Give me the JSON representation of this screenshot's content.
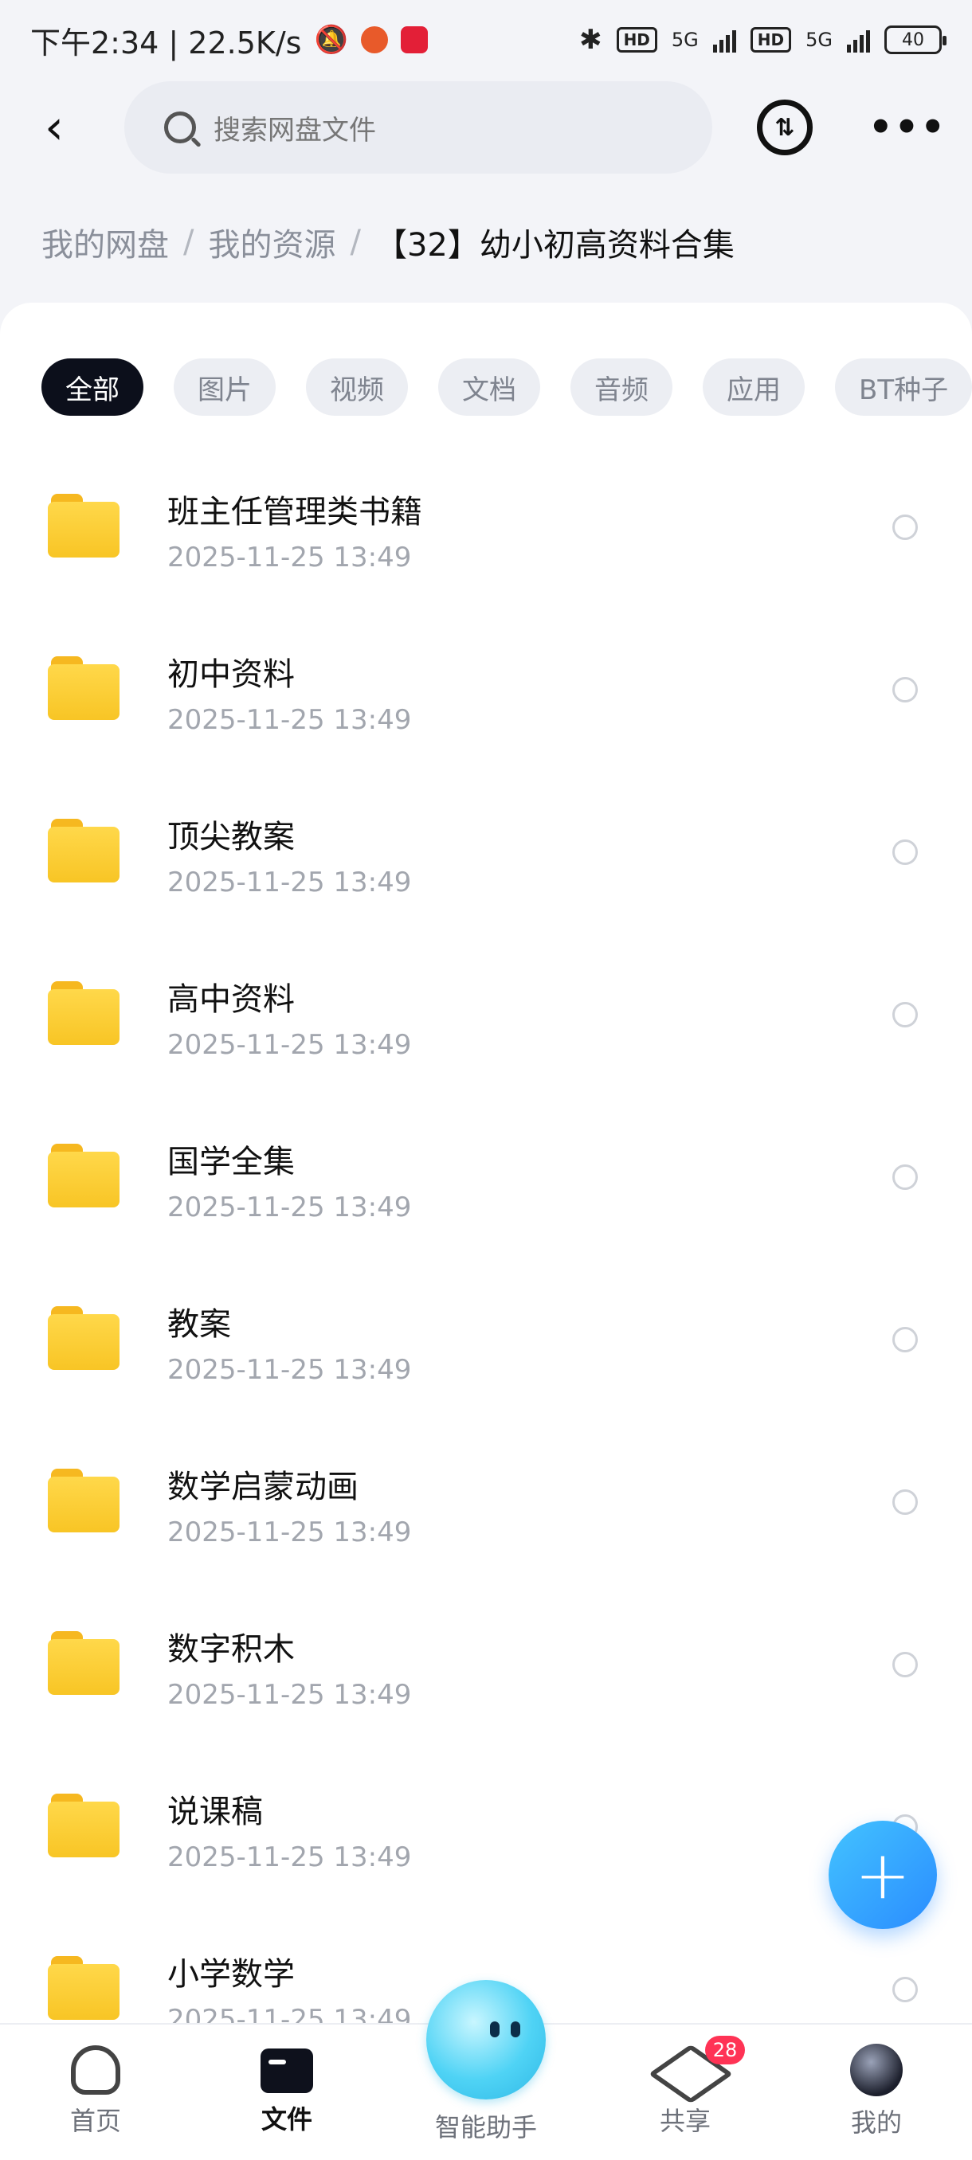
{
  "status_bar": {
    "time_speed": "下午2:34 | 22.5K/s",
    "hd_label": "HD",
    "network_label": "5G",
    "battery": "40"
  },
  "header": {
    "search_placeholder": "搜索网盘文件"
  },
  "breadcrumb": {
    "items": [
      "我的网盘",
      "我的资源"
    ],
    "separator": "/",
    "current": "【32】幼小初高资料合集"
  },
  "filters": [
    "全部",
    "图片",
    "视频",
    "文档",
    "音频",
    "应用",
    "BT种子"
  ],
  "files": [
    {
      "name": "班主任管理类书籍",
      "time": "2025-11-25  13:49"
    },
    {
      "name": "初中资料",
      "time": "2025-11-25  13:49"
    },
    {
      "name": "顶尖教案",
      "time": "2025-11-25  13:49"
    },
    {
      "name": "高中资料",
      "time": "2025-11-25  13:49"
    },
    {
      "name": "国学全集",
      "time": "2025-11-25  13:49"
    },
    {
      "name": "教案",
      "time": "2025-11-25  13:49"
    },
    {
      "name": "数学启蒙动画",
      "time": "2025-11-25  13:49"
    },
    {
      "name": "数字积木",
      "time": "2025-11-25  13:49"
    },
    {
      "name": "说课稿",
      "time": "2025-11-25  13:49"
    },
    {
      "name": "小学数学",
      "time": "2025-11-25  13:49"
    }
  ],
  "bottom_nav": {
    "home": "首页",
    "files": "文件",
    "assistant": "智能助手",
    "share": "共享",
    "share_badge": "28",
    "me": "我的"
  }
}
